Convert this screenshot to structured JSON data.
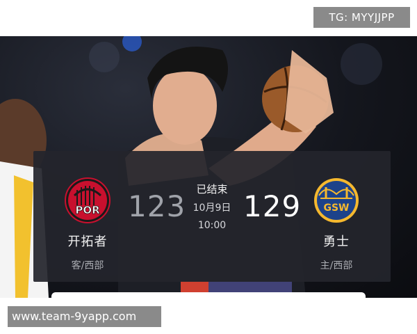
{
  "watermark": {
    "telegram": "TG: MYYJJPP",
    "url": "www.team-9yapp.com"
  },
  "game": {
    "status": "已结束",
    "date": "10月9日",
    "time": "10:00",
    "home": {
      "logo_text": "POR",
      "name": "开拓者",
      "conference": "客/西部",
      "score": "123",
      "color": "#c8102e"
    },
    "away": {
      "logo_text": "GSW",
      "name": "勇士",
      "conference": "主/西部",
      "score": "129",
      "color": "#1d428a"
    }
  }
}
